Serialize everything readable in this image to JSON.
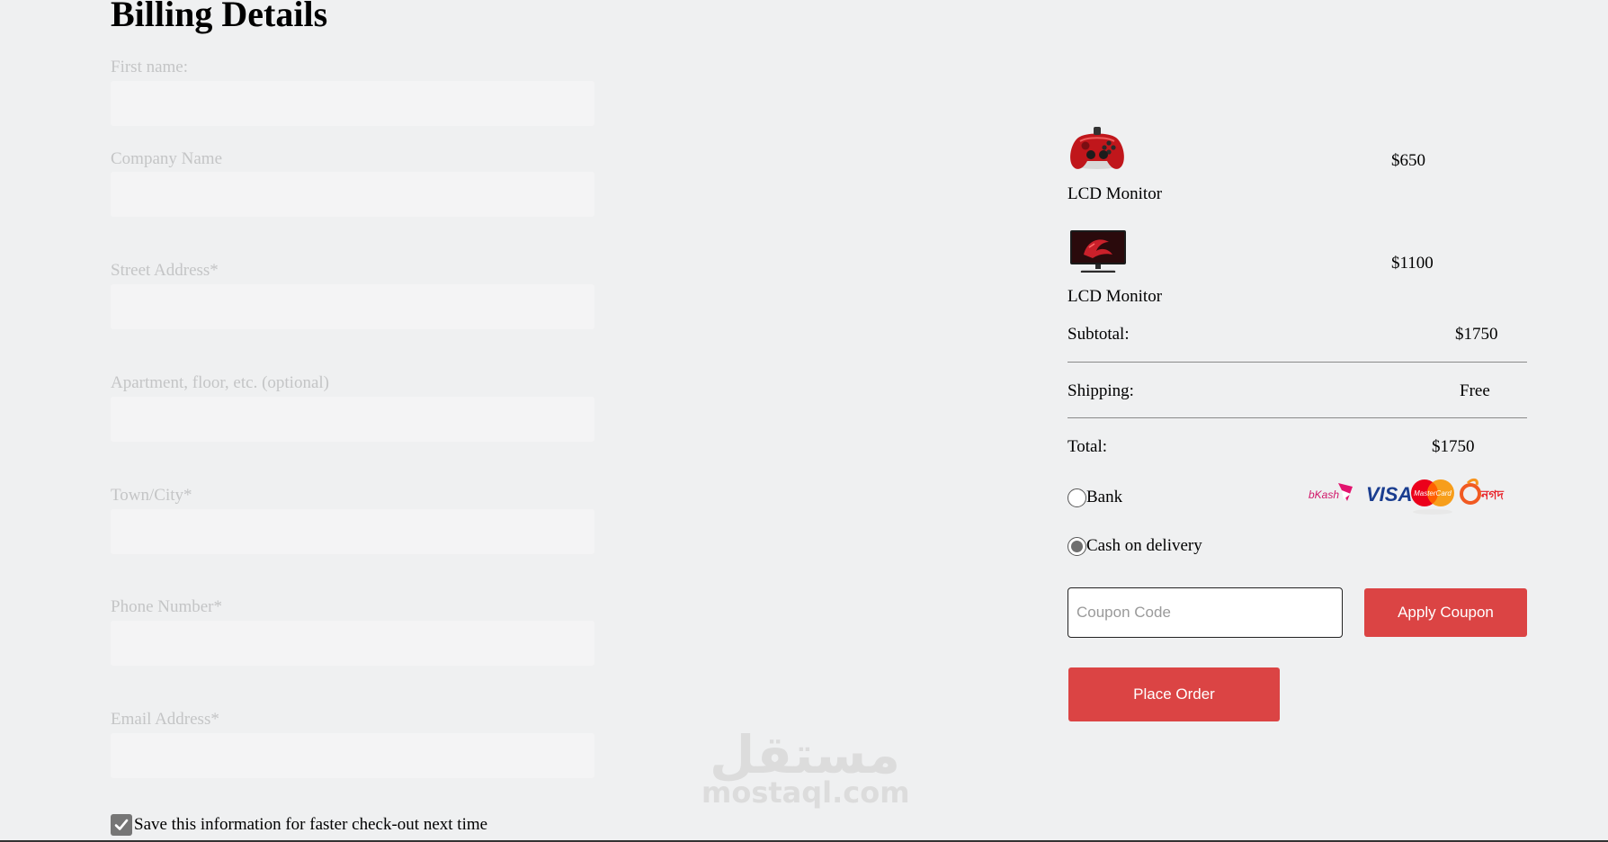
{
  "page": {
    "title": "Billing Details"
  },
  "form": {
    "fields": [
      {
        "label": "First name:",
        "value": "",
        "placeholder": ""
      },
      {
        "label": "Company Name",
        "value": "",
        "placeholder": ""
      },
      {
        "label": "Street Address*",
        "value": "",
        "placeholder": ""
      },
      {
        "label": "Apartment, floor, etc. (optional)",
        "value": "",
        "placeholder": ""
      },
      {
        "label": "Town/City*",
        "value": "",
        "placeholder": ""
      },
      {
        "label": "Phone Number*",
        "value": "",
        "placeholder": ""
      },
      {
        "label": "Email Address*",
        "value": "",
        "placeholder": ""
      }
    ],
    "save_info": {
      "label": "Save this information for faster check-out next time",
      "checked": true
    }
  },
  "order": {
    "items": [
      {
        "name": "LCD Monitor",
        "price": "$650",
        "image": "red-gamepad"
      },
      {
        "name": "LCD Monitor",
        "price": "$1100",
        "image": "monitor"
      }
    ],
    "subtotal": {
      "label": "Subtotal:",
      "value": "$1750"
    },
    "shipping": {
      "label": "Shipping:",
      "value": "Free"
    },
    "total": {
      "label": "Total:",
      "value": "$1750"
    },
    "payment": {
      "bank": {
        "label": "Bank",
        "selected": false
      },
      "cod": {
        "label": "Cash on delivery",
        "selected": true
      },
      "logos": [
        {
          "name": "bkash-logo",
          "text": "bKash"
        },
        {
          "name": "visa-logo",
          "text": "VISA"
        },
        {
          "name": "mastercard-logo",
          "text": "MasterCard"
        },
        {
          "name": "nagad-logo",
          "text": "নগদ"
        }
      ]
    },
    "coupon": {
      "placeholder": "Coupon Code",
      "value": "",
      "apply_label": "Apply Coupon"
    },
    "place_order_label": "Place Order"
  },
  "watermark": {
    "arabic": "مستقل",
    "latin": "mostaql.com"
  },
  "colors": {
    "accent": "#db4444",
    "background": "#eff0f1",
    "input_bg": "#f4f4f5"
  }
}
